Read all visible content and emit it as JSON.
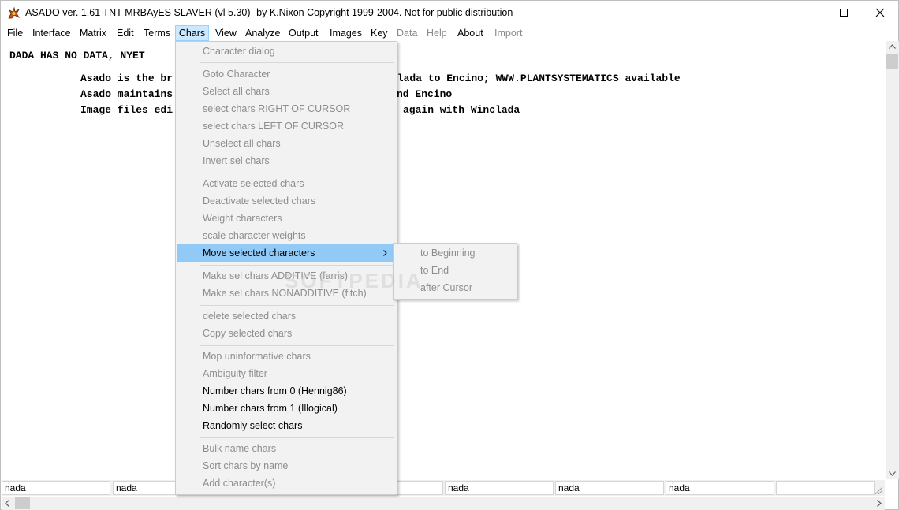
{
  "window": {
    "title": "ASADO ver. 1.61 TNT-MRBAyES SLAVER (vl 5.30)- by K.Nixon Copyright 1999-2004. Not for public distribution",
    "controls": {
      "minimize": "minimize-icon",
      "maximize": "maximize-icon",
      "close": "close-icon"
    }
  },
  "menubar": {
    "items": [
      {
        "label": "File",
        "enabled": true
      },
      {
        "label": "Interface",
        "enabled": true
      },
      {
        "label": "Matrix",
        "enabled": true
      },
      {
        "label": "Edit",
        "enabled": true
      },
      {
        "label": "Terms",
        "enabled": true
      },
      {
        "label": "Chars",
        "enabled": true,
        "active": true
      },
      {
        "label": "View",
        "enabled": true
      },
      {
        "label": "Analyze",
        "enabled": true
      },
      {
        "label": "Output",
        "enabled": true
      },
      {
        "label": "Images",
        "enabled": true
      },
      {
        "label": "Key",
        "enabled": true
      },
      {
        "label": "Data",
        "enabled": false
      },
      {
        "label": "Help",
        "enabled": false
      },
      {
        "label": "About",
        "enabled": true
      },
      {
        "label": "Import",
        "enabled": false
      }
    ]
  },
  "content": {
    "lines": [
      "DADA HAS NO DATA, NYET",
      "Asado is the br",
      "clada to Encino; WWW.PLANTSYSTEMATICS available",
      "Asado maintains",
      "nd Encino",
      "Image files edi",
      "again with Winclada"
    ]
  },
  "chars_menu": {
    "items": [
      {
        "label": "Character dialog",
        "enabled": false
      },
      {
        "label": "Goto Character",
        "enabled": false
      },
      {
        "label": "Select all chars",
        "enabled": false
      },
      {
        "label": "select chars RIGHT OF CURSOR",
        "enabled": false
      },
      {
        "label": "select chars LEFT OF CURSOR",
        "enabled": false
      },
      {
        "label": "Unselect all chars",
        "enabled": false
      },
      {
        "label": "Invert sel chars",
        "enabled": false
      },
      {
        "label": "Activate selected chars",
        "enabled": false
      },
      {
        "label": "Deactivate selected chars",
        "enabled": false
      },
      {
        "label": "Weight characters",
        "enabled": false
      },
      {
        "label": "scale character weights",
        "enabled": false
      },
      {
        "label": "Move selected characters",
        "enabled": true,
        "highlighted": true,
        "submenu": true
      },
      {
        "label": "Make sel chars ADDITIVE (farris)",
        "enabled": false
      },
      {
        "label": "Make sel chars NONADDITIVE (fitch)",
        "enabled": false
      },
      {
        "label": "delete selected chars",
        "enabled": false
      },
      {
        "label": "Copy selected chars",
        "enabled": false
      },
      {
        "label": "Mop uninformative chars",
        "enabled": false
      },
      {
        "label": "Ambiguity filter",
        "enabled": false
      },
      {
        "label": "Number chars from 0 (Hennig86)",
        "enabled": true
      },
      {
        "label": "Number chars from 1 (Illogical)",
        "enabled": true
      },
      {
        "label": "Randomly select chars",
        "enabled": true
      },
      {
        "label": "Bulk name chars",
        "enabled": false
      },
      {
        "label": "Sort chars by name",
        "enabled": false
      },
      {
        "label": "Add character(s)",
        "enabled": false
      }
    ]
  },
  "move_submenu": {
    "items": [
      {
        "label": "to Beginning",
        "enabled": false
      },
      {
        "label": "to End",
        "enabled": false
      },
      {
        "label": "after Cursor",
        "enabled": false
      }
    ]
  },
  "statusbar": {
    "cells": [
      "nada",
      "nada",
      "",
      "",
      "nada",
      "nada",
      "nada",
      ""
    ]
  },
  "watermark": "SOFTPEDIA",
  "colors": {
    "menu_highlight": "#91c9f7",
    "menubar_active": "#cce8ff",
    "disabled_text": "#8d8d8d"
  }
}
